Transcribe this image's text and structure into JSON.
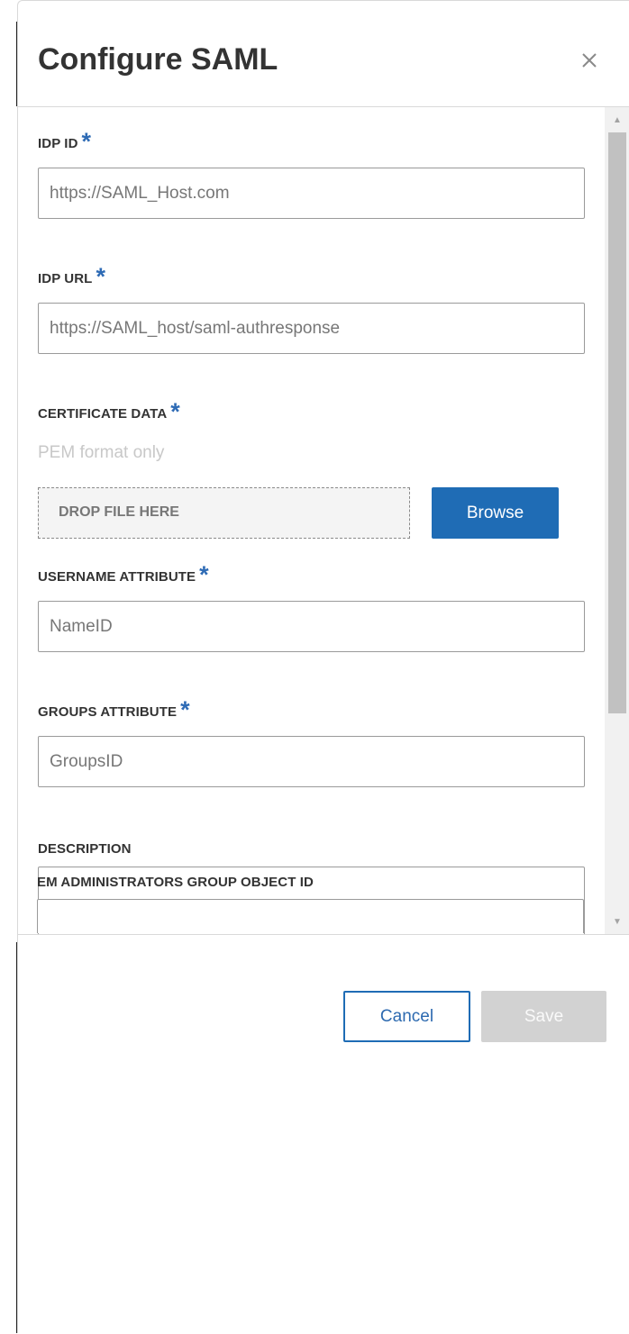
{
  "dialog": {
    "title": "Configure SAML",
    "close_icon": "close-icon"
  },
  "fields": {
    "idp_id": {
      "label": "IDP ID",
      "required": "*",
      "placeholder": "https://SAML_Host.com",
      "value": ""
    },
    "idp_url": {
      "label": "IDP URL",
      "required": "*",
      "placeholder": "https://SAML_host/saml-authresponse",
      "value": ""
    },
    "certificate": {
      "label": "CERTIFICATE DATA",
      "required": "*",
      "hint": "PEM format only",
      "drop_text": "DROP FILE HERE",
      "browse_label": "Browse"
    },
    "username_attr": {
      "label": "USERNAME ATTRIBUTE",
      "required": "*",
      "placeholder": "NameID",
      "value": ""
    },
    "groups_attr": {
      "label": "GROUPS ATTRIBUTE",
      "required": "*",
      "placeholder": "GroupsID",
      "value": ""
    },
    "description": {
      "label": "DESCRIPTION",
      "value": ""
    },
    "em_admin_group": {
      "label": "EM ADMINISTRATORS GROUP OBJECT ID",
      "value": ""
    }
  },
  "footer": {
    "cancel_label": "Cancel",
    "save_label": "Save"
  },
  "colors": {
    "accent": "#1f6cb5",
    "required": "#2e6bb5",
    "disabled": "#d2d2d2"
  }
}
